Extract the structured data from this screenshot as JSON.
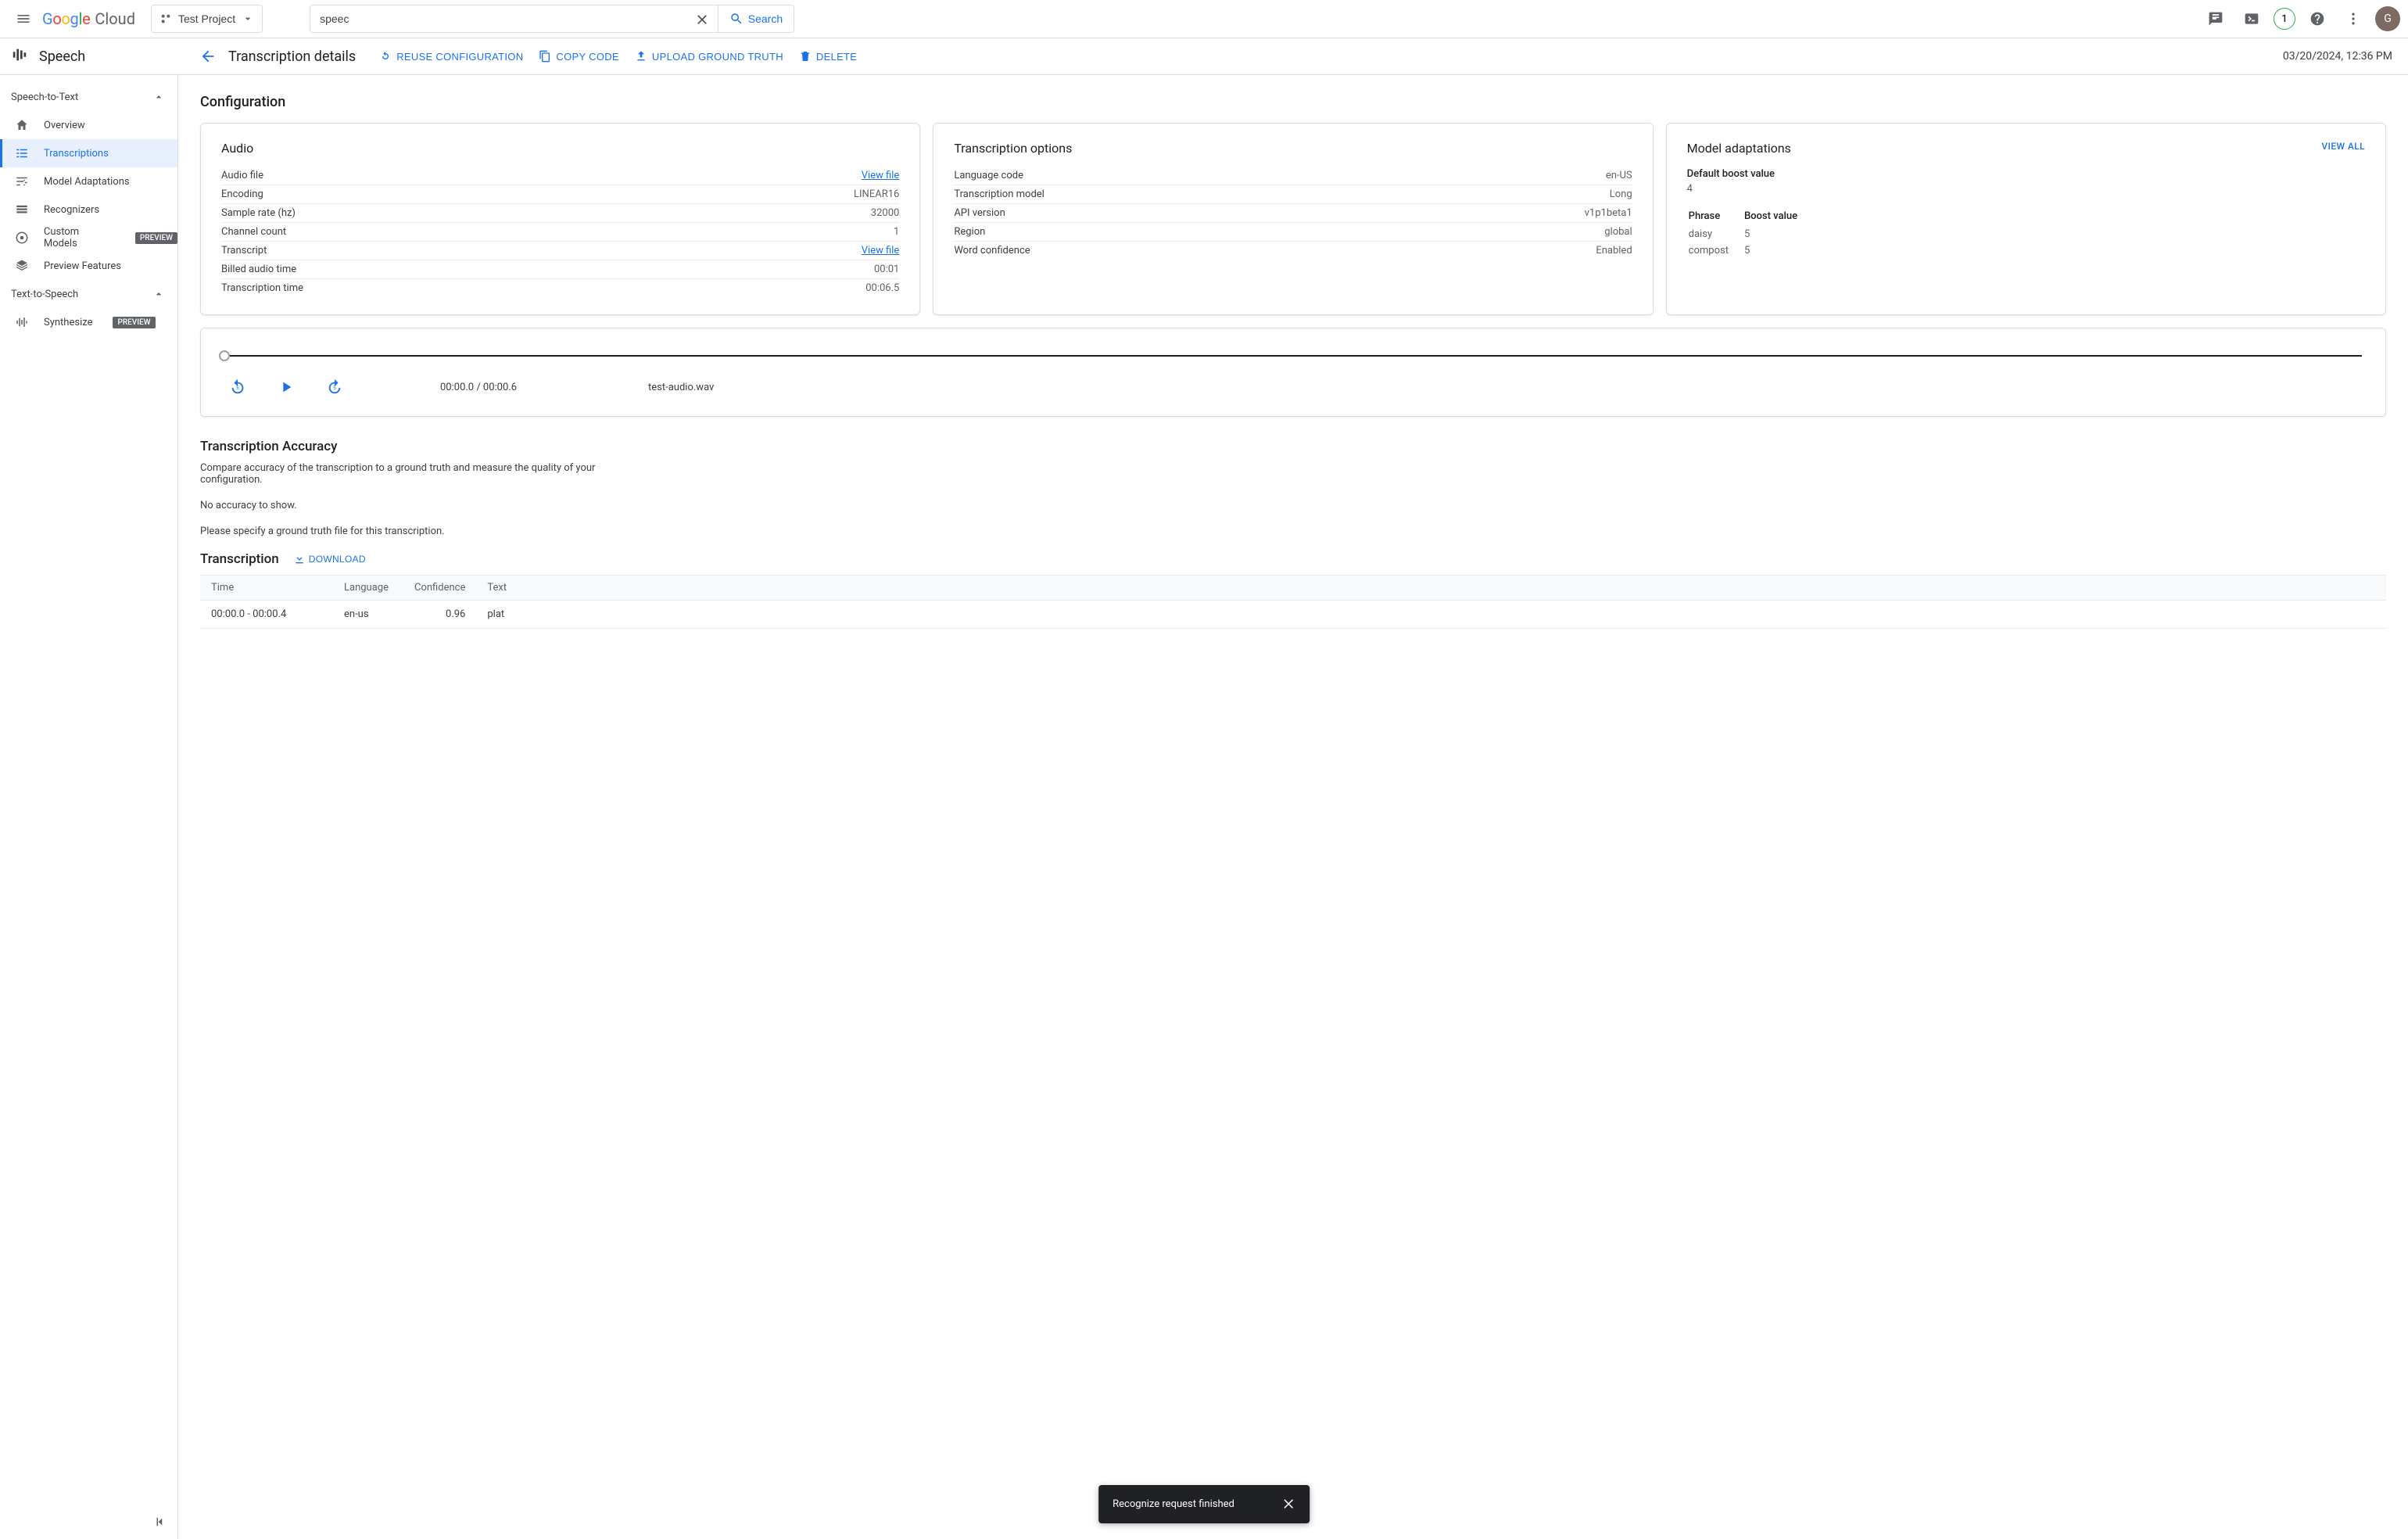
{
  "topbar": {
    "logo_cloud": "Cloud",
    "project_name": "Test Project",
    "search_value": "speec",
    "search_button": "Search",
    "trial_badge": "1",
    "avatar_initial": "G"
  },
  "productbar": {
    "product_name": "Speech",
    "page_title": "Transcription details",
    "actions": {
      "reuse": "REUSE CONFIGURATION",
      "copy": "COPY CODE",
      "upload": "UPLOAD GROUND TRUTH",
      "delete": "DELETE"
    },
    "timestamp": "03/20/2024, 12:36 PM"
  },
  "sidebar": {
    "section1_title": "Speech-to-Text",
    "items1": [
      {
        "label": "Overview"
      },
      {
        "label": "Transcriptions"
      },
      {
        "label": "Model Adaptations"
      },
      {
        "label": "Recognizers"
      },
      {
        "label": "Custom Models",
        "badge": "PREVIEW"
      },
      {
        "label": "Preview Features"
      }
    ],
    "section2_title": "Text-to-Speech",
    "items2": [
      {
        "label": "Synthesize",
        "badge": "PREVIEW"
      }
    ]
  },
  "config": {
    "section_title": "Configuration",
    "audio_card": {
      "title": "Audio",
      "rows": [
        {
          "k": "Audio file",
          "v": "View file",
          "link": true
        },
        {
          "k": "Encoding",
          "v": "LINEAR16"
        },
        {
          "k": "Sample rate (hz)",
          "v": "32000"
        },
        {
          "k": "Channel count",
          "v": "1"
        },
        {
          "k": "Transcript",
          "v": "View file",
          "link": true
        },
        {
          "k": "Billed audio time",
          "v": "00:01"
        },
        {
          "k": "Transcription time",
          "v": "00:06.5"
        }
      ]
    },
    "options_card": {
      "title": "Transcription options",
      "rows": [
        {
          "k": "Language code",
          "v": "en-US"
        },
        {
          "k": "Transcription model",
          "v": "Long"
        },
        {
          "k": "API version",
          "v": "v1p1beta1"
        },
        {
          "k": "Region",
          "v": "global"
        },
        {
          "k": "Word confidence",
          "v": "Enabled"
        }
      ]
    },
    "adapt_card": {
      "title": "Model adaptations",
      "view_all": "VIEW ALL",
      "default_label": "Default boost value",
      "default_value": "4",
      "headers": {
        "phrase": "Phrase",
        "boost": "Boost value"
      },
      "rows": [
        {
          "phrase": "daisy",
          "boost": "5"
        },
        {
          "phrase": "compost",
          "boost": "5"
        }
      ]
    }
  },
  "player": {
    "time": "00:00.0 / 00:00.6",
    "file": "test-audio.wav"
  },
  "accuracy": {
    "title": "Transcription Accuracy",
    "desc": "Compare accuracy of the transcription to a ground truth and measure the quality of your configuration.",
    "none": "No accuracy to show.",
    "hint": "Please specify a ground truth file for this transcription."
  },
  "transcription": {
    "title": "Transcription",
    "download": "DOWNLOAD",
    "headers": {
      "time": "Time",
      "lang": "Language",
      "conf": "Confidence",
      "text": "Text"
    },
    "rows": [
      {
        "time": "00:00.0 - 00:00.4",
        "lang": "en-us",
        "conf": "0.96",
        "text": "plat"
      }
    ]
  },
  "toast": {
    "text": "Recognize request finished"
  }
}
